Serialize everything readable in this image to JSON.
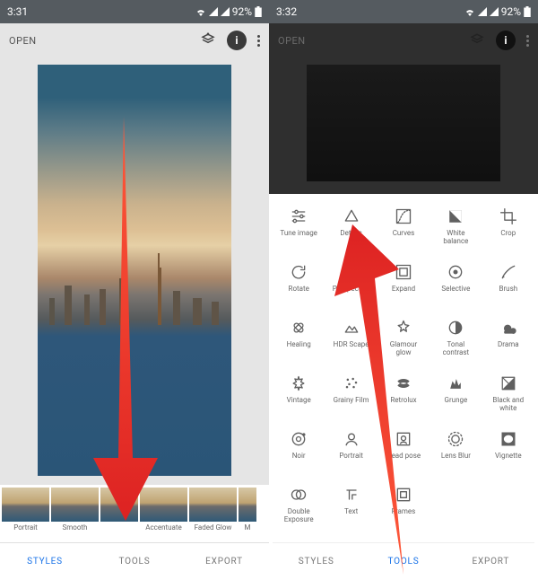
{
  "left": {
    "status": {
      "time": "3:31",
      "battery": "92%"
    },
    "appbar": {
      "open": "OPEN"
    },
    "styles": [
      {
        "label": "Portrait"
      },
      {
        "label": "Smooth"
      },
      {
        "label": "Accentuate"
      },
      {
        "label": "Faded Glow"
      },
      {
        "label": "M"
      }
    ],
    "tabs": {
      "styles": "STYLES",
      "tools": "TOOLS",
      "export": "EXPORT"
    },
    "active_tab": "styles"
  },
  "right": {
    "status": {
      "time": "3:32",
      "battery": "92%"
    },
    "appbar": {
      "open": "OPEN"
    },
    "tools": [
      {
        "label": "Tune image",
        "icon": "tune"
      },
      {
        "label": "Details",
        "icon": "details"
      },
      {
        "label": "Curves",
        "icon": "curves"
      },
      {
        "label": "White\nbalance",
        "icon": "wb"
      },
      {
        "label": "Crop",
        "icon": "crop"
      },
      {
        "label": "Rotate",
        "icon": "rotate"
      },
      {
        "label": "Perspective",
        "icon": "perspective"
      },
      {
        "label": "Expand",
        "icon": "expand"
      },
      {
        "label": "Selective",
        "icon": "selective"
      },
      {
        "label": "Brush",
        "icon": "brush"
      },
      {
        "label": "Healing",
        "icon": "healing"
      },
      {
        "label": "HDR Scape",
        "icon": "hdr"
      },
      {
        "label": "Glamour\nglow",
        "icon": "glow"
      },
      {
        "label": "Tonal\ncontrast",
        "icon": "tonal"
      },
      {
        "label": "Drama",
        "icon": "drama"
      },
      {
        "label": "Vintage",
        "icon": "vintage"
      },
      {
        "label": "Grainy Film",
        "icon": "grain"
      },
      {
        "label": "Retrolux",
        "icon": "retro"
      },
      {
        "label": "Grunge",
        "icon": "grunge"
      },
      {
        "label": "Black and\nwhite",
        "icon": "bw"
      },
      {
        "label": "Noir",
        "icon": "noir"
      },
      {
        "label": "Portrait",
        "icon": "portrait"
      },
      {
        "label": "Head pose",
        "icon": "head"
      },
      {
        "label": "Lens Blur",
        "icon": "blur"
      },
      {
        "label": "Vignette",
        "icon": "vignette"
      },
      {
        "label": "Double\nExposure",
        "icon": "double"
      },
      {
        "label": "Text",
        "icon": "text"
      },
      {
        "label": "Frames",
        "icon": "frames"
      }
    ],
    "tabs": {
      "styles": "STYLES",
      "tools": "TOOLS",
      "export": "EXPORT"
    },
    "active_tab": "tools"
  },
  "colors": {
    "accent": "#1a73e8",
    "arrow": "#e94b35"
  }
}
